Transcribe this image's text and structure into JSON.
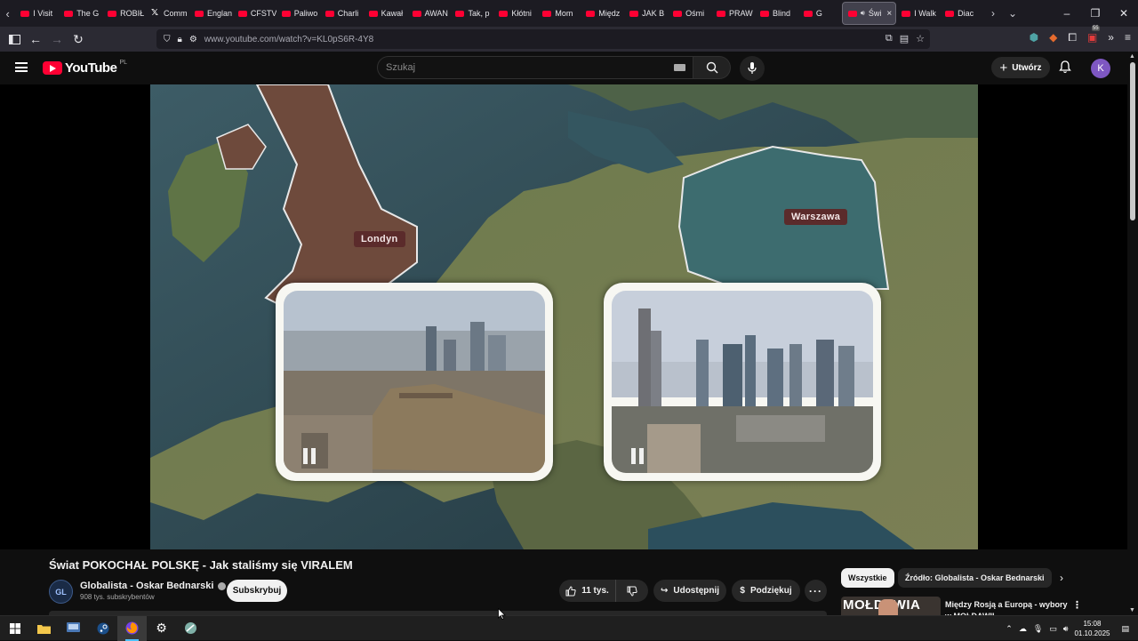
{
  "browser": {
    "tabs": [
      {
        "label": "I Visit",
        "favicon": "youtube-icon"
      },
      {
        "label": "The G",
        "favicon": "youtube-icon"
      },
      {
        "label": "ROBIŁ",
        "favicon": "youtube-icon"
      },
      {
        "label": "Comm",
        "favicon": "x-icon"
      },
      {
        "label": "Englan",
        "favicon": "youtube-icon"
      },
      {
        "label": "CFSTV",
        "favicon": "youtube-icon"
      },
      {
        "label": "Paliwo",
        "favicon": "youtube-icon"
      },
      {
        "label": "Charli",
        "favicon": "youtube-icon"
      },
      {
        "label": "Kawał",
        "favicon": "youtube-icon"
      },
      {
        "label": "AWAN",
        "favicon": "youtube-icon"
      },
      {
        "label": "Tak, p",
        "favicon": "youtube-icon"
      },
      {
        "label": "Kłótni",
        "favicon": "youtube-icon"
      },
      {
        "label": "Mom",
        "favicon": "youtube-icon"
      },
      {
        "label": "Międz",
        "favicon": "youtube-icon"
      },
      {
        "label": "JAK B",
        "favicon": "youtube-icon"
      },
      {
        "label": "Ośmi",
        "favicon": "youtube-icon"
      },
      {
        "label": "PRAW",
        "favicon": "youtube-icon"
      },
      {
        "label": "Blind",
        "favicon": "youtube-icon"
      },
      {
        "label": "G",
        "favicon": "youtube-icon"
      }
    ],
    "active_tab": {
      "label": "Świ",
      "close": "×"
    },
    "after_tabs": [
      {
        "label": "I Walk",
        "favicon": "youtube-icon"
      },
      {
        "label": "Diac",
        "favicon": "youtube-icon"
      }
    ],
    "url_host": "www.youtube.com",
    "url_path": "/watch?v=KL0pS6R-4Y8",
    "extension_badge": "55"
  },
  "youtube": {
    "logo_text": "YouTube",
    "country_code": "PL",
    "search_placeholder": "Szukaj",
    "create_label": "Utwórz",
    "avatar_letter": "K"
  },
  "video": {
    "labels": {
      "london": "Londyn",
      "warsaw": "Warszawa"
    },
    "title": "Świat POKOCHAŁ POLSKĘ - Jak staliśmy się VIRALEM",
    "channel": {
      "name": "Globalista - Oskar Bednarski",
      "subscribers": "908 tys. subskrybentów",
      "avatar_text": "GL"
    },
    "subscribe_label": "Subskrybuj",
    "likes": "11 tys.",
    "share_label": "Udostępnij",
    "thanks_label": "Podziękuj"
  },
  "sidebar": {
    "chips": [
      "Wszystkie",
      "Źródło: Globalista - Oskar Bednarski"
    ],
    "recommendation": {
      "thumb_text": "MOŁDAWIA",
      "title": "Między Rosją a Europą - wybory w MOŁDAWII"
    }
  },
  "taskbar": {
    "time": "15:08",
    "date": "01.10.2025"
  },
  "colors": {
    "youtube_red": "#ff0033",
    "accent": "#4cc2ff",
    "label_bg": "#5b2b2b"
  }
}
